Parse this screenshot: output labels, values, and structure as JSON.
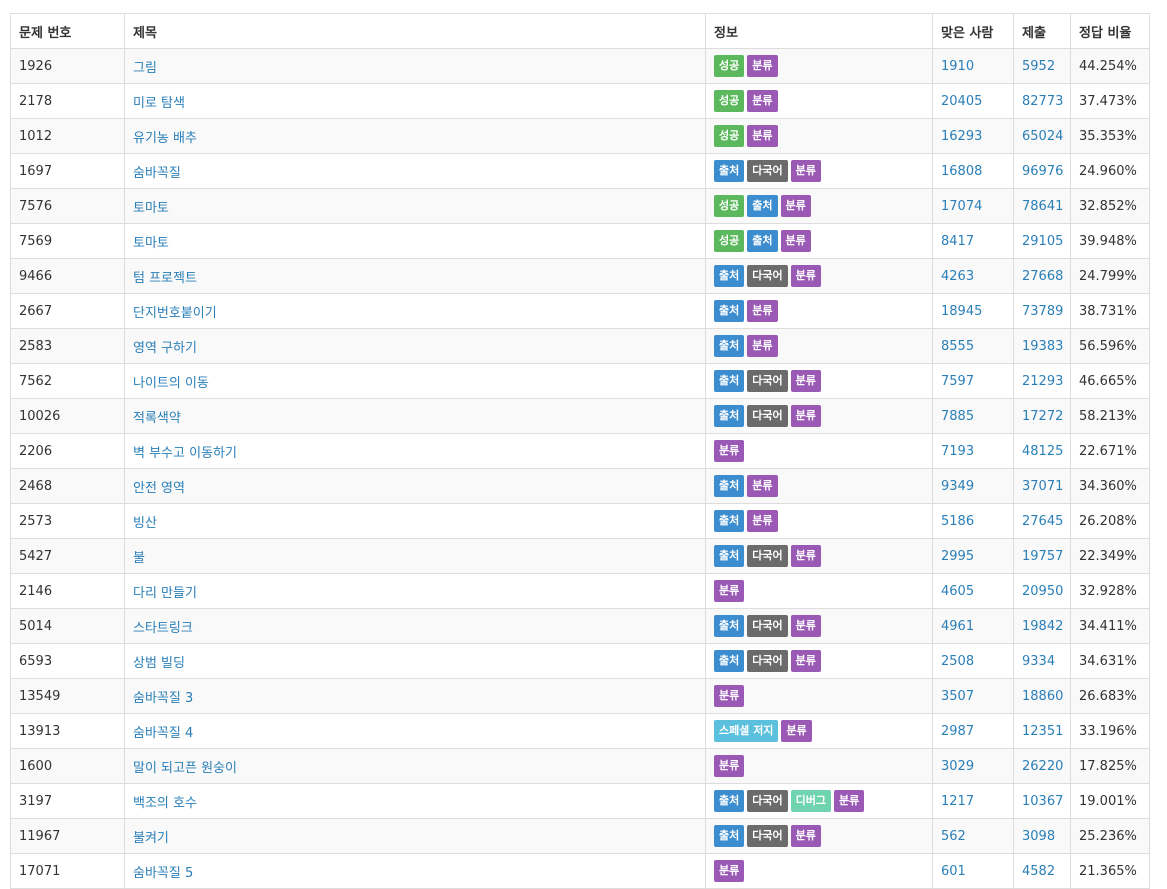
{
  "header": {
    "id": "문제 번호",
    "title": "제목",
    "info": "정보",
    "solved": "맞은 사람",
    "submit": "제출",
    "ratio": "정답 비율"
  },
  "tag_colors": {
    "성공": "#5cb85c",
    "출처": "#3c8dcf",
    "다국어": "#6b6b6b",
    "분류": "#9b59b6",
    "스페셜 저지": "#5bc0de",
    "디버그": "#6fd3b0"
  },
  "rows": [
    {
      "id": "1926",
      "title": "그림",
      "tags": [
        "성공",
        "분류"
      ],
      "solved": "1910",
      "submit": "5952",
      "ratio": "44.254%"
    },
    {
      "id": "2178",
      "title": "미로 탐색",
      "tags": [
        "성공",
        "분류"
      ],
      "solved": "20405",
      "submit": "82773",
      "ratio": "37.473%"
    },
    {
      "id": "1012",
      "title": "유기농 배추",
      "tags": [
        "성공",
        "분류"
      ],
      "solved": "16293",
      "submit": "65024",
      "ratio": "35.353%"
    },
    {
      "id": "1697",
      "title": "숨바꼭질",
      "tags": [
        "출처",
        "다국어",
        "분류"
      ],
      "solved": "16808",
      "submit": "96976",
      "ratio": "24.960%"
    },
    {
      "id": "7576",
      "title": "토마토",
      "tags": [
        "성공",
        "출처",
        "분류"
      ],
      "solved": "17074",
      "submit": "78641",
      "ratio": "32.852%"
    },
    {
      "id": "7569",
      "title": "토마토",
      "tags": [
        "성공",
        "출처",
        "분류"
      ],
      "solved": "8417",
      "submit": "29105",
      "ratio": "39.948%"
    },
    {
      "id": "9466",
      "title": "텀 프로젝트",
      "tags": [
        "출처",
        "다국어",
        "분류"
      ],
      "solved": "4263",
      "submit": "27668",
      "ratio": "24.799%"
    },
    {
      "id": "2667",
      "title": "단지번호붙이기",
      "tags": [
        "출처",
        "분류"
      ],
      "solved": "18945",
      "submit": "73789",
      "ratio": "38.731%"
    },
    {
      "id": "2583",
      "title": "영역 구하기",
      "tags": [
        "출처",
        "분류"
      ],
      "solved": "8555",
      "submit": "19383",
      "ratio": "56.596%"
    },
    {
      "id": "7562",
      "title": "나이트의 이동",
      "tags": [
        "출처",
        "다국어",
        "분류"
      ],
      "solved": "7597",
      "submit": "21293",
      "ratio": "46.665%"
    },
    {
      "id": "10026",
      "title": "적록색약",
      "tags": [
        "출처",
        "다국어",
        "분류"
      ],
      "solved": "7885",
      "submit": "17272",
      "ratio": "58.213%"
    },
    {
      "id": "2206",
      "title": "벽 부수고 이동하기",
      "tags": [
        "분류"
      ],
      "solved": "7193",
      "submit": "48125",
      "ratio": "22.671%"
    },
    {
      "id": "2468",
      "title": "안전 영역",
      "tags": [
        "출처",
        "분류"
      ],
      "solved": "9349",
      "submit": "37071",
      "ratio": "34.360%"
    },
    {
      "id": "2573",
      "title": "빙산",
      "tags": [
        "출처",
        "분류"
      ],
      "solved": "5186",
      "submit": "27645",
      "ratio": "26.208%"
    },
    {
      "id": "5427",
      "title": "불",
      "tags": [
        "출처",
        "다국어",
        "분류"
      ],
      "solved": "2995",
      "submit": "19757",
      "ratio": "22.349%"
    },
    {
      "id": "2146",
      "title": "다리 만들기",
      "tags": [
        "분류"
      ],
      "solved": "4605",
      "submit": "20950",
      "ratio": "32.928%"
    },
    {
      "id": "5014",
      "title": "스타트링크",
      "tags": [
        "출처",
        "다국어",
        "분류"
      ],
      "solved": "4961",
      "submit": "19842",
      "ratio": "34.411%"
    },
    {
      "id": "6593",
      "title": "상범 빌딩",
      "tags": [
        "출처",
        "다국어",
        "분류"
      ],
      "solved": "2508",
      "submit": "9334",
      "ratio": "34.631%"
    },
    {
      "id": "13549",
      "title": "숨바꼭질 3",
      "tags": [
        "분류"
      ],
      "solved": "3507",
      "submit": "18860",
      "ratio": "26.683%"
    },
    {
      "id": "13913",
      "title": "숨바꼭질 4",
      "tags": [
        "스페셜 저지",
        "분류"
      ],
      "solved": "2987",
      "submit": "12351",
      "ratio": "33.196%"
    },
    {
      "id": "1600",
      "title": "말이 되고픈 원숭이",
      "tags": [
        "분류"
      ],
      "solved": "3029",
      "submit": "26220",
      "ratio": "17.825%"
    },
    {
      "id": "3197",
      "title": "백조의 호수",
      "tags": [
        "출처",
        "다국어",
        "디버그",
        "분류"
      ],
      "solved": "1217",
      "submit": "10367",
      "ratio": "19.001%"
    },
    {
      "id": "11967",
      "title": "불켜기",
      "tags": [
        "출처",
        "다국어",
        "분류"
      ],
      "solved": "562",
      "submit": "3098",
      "ratio": "25.236%"
    },
    {
      "id": "17071",
      "title": "숨바꼭질 5",
      "tags": [
        "분류"
      ],
      "solved": "601",
      "submit": "4582",
      "ratio": "21.365%"
    }
  ]
}
